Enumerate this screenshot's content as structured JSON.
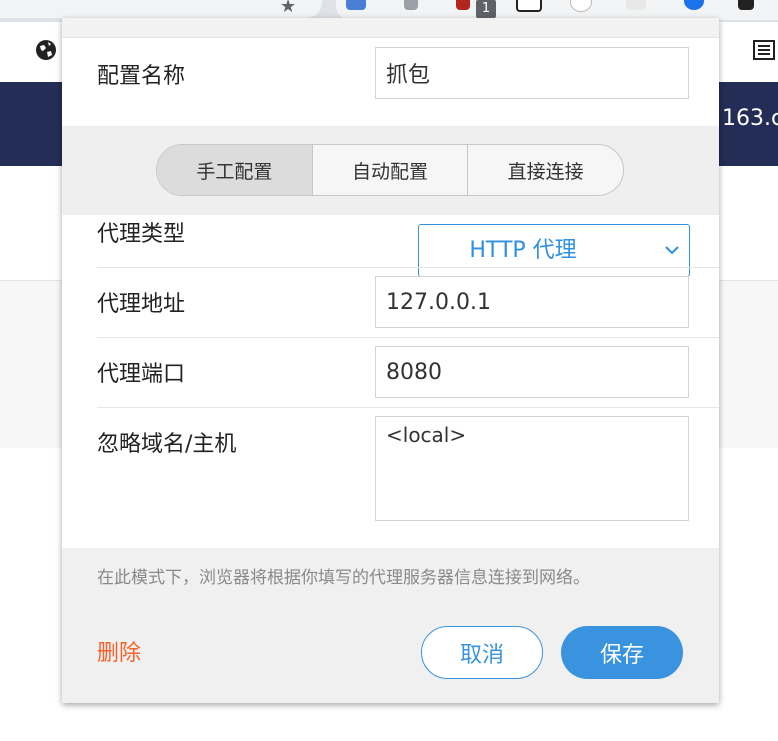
{
  "browser": {
    "extension_badge": "1",
    "page_header_text": "163.c"
  },
  "popup": {
    "config_name_label": "配置名称",
    "config_name_value": "抓包",
    "modes": [
      {
        "label": "手工配置",
        "active": true
      },
      {
        "label": "自动配置",
        "active": false
      },
      {
        "label": "直接连接",
        "active": false
      }
    ],
    "proxy_type_label": "代理类型",
    "proxy_type_value": "HTTP 代理",
    "proxy_address_label": "代理地址",
    "proxy_address_value": "127.0.0.1",
    "proxy_port_label": "代理端口",
    "proxy_port_value": "8080",
    "bypass_label": "忽略域名/主机",
    "bypass_value": "<local>",
    "hint": "在此模式下，浏览器将根据你填写的代理服务器信息连接到网络。",
    "delete_label": "删除",
    "cancel_label": "取消",
    "save_label": "保存"
  },
  "colors": {
    "accent": "#3a93de",
    "danger": "#f2622a",
    "header_bg": "#232d55"
  }
}
